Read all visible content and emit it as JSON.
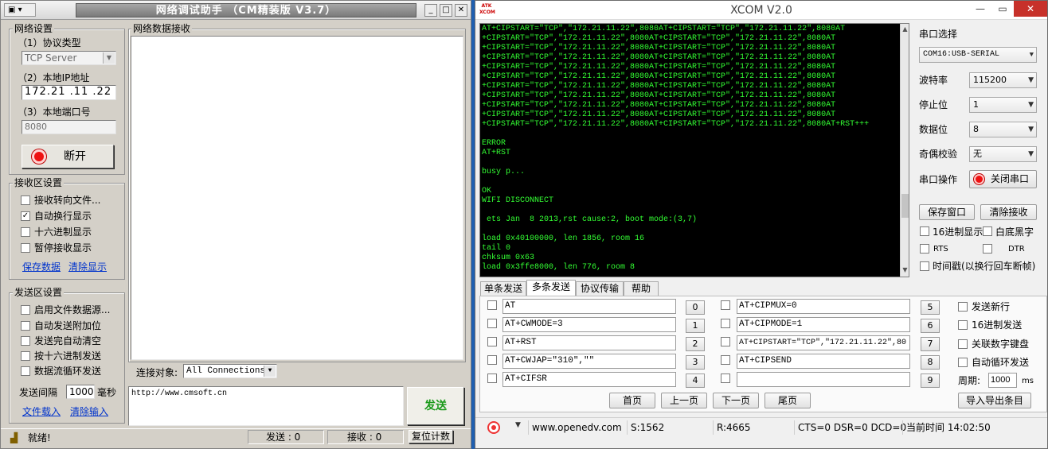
{
  "left": {
    "title": "网络调试助手 （CM精装版 V3.7）",
    "net_settings": {
      "title": "网络设置",
      "protocol_label": "（1）协议类型",
      "protocol_value": "TCP Server",
      "ip_label": "（2）本地IP地址",
      "ip_value": "172.21 .11 .22",
      "port_label": "（3）本地端口号",
      "port_value": "8080",
      "disconnect_label": "断开"
    },
    "recv_settings": {
      "title": "接收区设置",
      "options": [
        {
          "label": "接收转向文件...",
          "checked": false
        },
        {
          "label": "自动换行显示",
          "checked": true
        },
        {
          "label": "十六进制显示",
          "checked": false
        },
        {
          "label": "暂停接收显示",
          "checked": false
        }
      ],
      "save_link": "保存数据",
      "clear_link": "清除显示"
    },
    "send_settings": {
      "title": "发送区设置",
      "options": [
        {
          "label": "启用文件数据源...",
          "checked": false
        },
        {
          "label": "自动发送附加位",
          "checked": false
        },
        {
          "label": "发送完自动清空",
          "checked": false
        },
        {
          "label": "按十六进制发送",
          "checked": false
        },
        {
          "label": "数据流循环发送",
          "checked": false
        }
      ],
      "interval_label": "发送间隔",
      "interval_value": "1000",
      "interval_unit": "毫秒",
      "load_link": "文件载入",
      "clear_input_link": "清除输入"
    },
    "recv_area_title": "网络数据接收",
    "connect_label": "连接对象:",
    "connect_value": "All Connections",
    "send_text": "http://www.cmsoft.cn",
    "send_button": "发送",
    "status": {
      "ready": "就绪!",
      "send_count": "发送 : 0",
      "recv_count": "接收 : 0",
      "reset_button": "复位计数"
    }
  },
  "right": {
    "title": "XCOM V2.0",
    "logo_text": "ATK XCOM",
    "terminal_text": "AT+CIPSTART=\"TCP\",\"172.21.11.22\",8080AT+CIPSTART=\"TCP\",\"172.21.11.22\",8080AT\n+CIPSTART=\"TCP\",\"172.21.11.22\",8080AT+CIPSTART=\"TCP\",\"172.21.11.22\",8080AT\n+CIPSTART=\"TCP\",\"172.21.11.22\",8080AT+CIPSTART=\"TCP\",\"172.21.11.22\",8080AT\n+CIPSTART=\"TCP\",\"172.21.11.22\",8080AT+CIPSTART=\"TCP\",\"172.21.11.22\",8080AT\n+CIPSTART=\"TCP\",\"172.21.11.22\",8080AT+CIPSTART=\"TCP\",\"172.21.11.22\",8080AT\n+CIPSTART=\"TCP\",\"172.21.11.22\",8080AT+CIPSTART=\"TCP\",\"172.21.11.22\",8080AT\n+CIPSTART=\"TCP\",\"172.21.11.22\",8080AT+CIPSTART=\"TCP\",\"172.21.11.22\",8080AT\n+CIPSTART=\"TCP\",\"172.21.11.22\",8080AT+CIPSTART=\"TCP\",\"172.21.11.22\",8080AT\n+CIPSTART=\"TCP\",\"172.21.11.22\",8080AT+CIPSTART=\"TCP\",\"172.21.11.22\",8080AT\n+CIPSTART=\"TCP\",\"172.21.11.22\",8080AT+CIPSTART=\"TCP\",\"172.21.11.22\",8080AT\n+CIPSTART=\"TCP\",\"172.21.11.22\",8080AT+CIPSTART=\"TCP\",\"172.21.11.22\",8080AT+RST+++\n\nERROR\nAT+RST\n\nbusy p...\n\nOK\nWIFI DISCONNECT\n\n ets Jan  8 2013,rst cause:2, boot mode:(3,7)\n\nload 0x40100000, len 1856, room 16\ntail 0\nchksum 0x63\nload 0x3ffe8000, len 776, room 8",
    "sidebar": {
      "port_select_label": "串口选择",
      "port_value": "COM16:USB-SERIAL",
      "baud_label": "波特率",
      "baud_value": "115200",
      "stop_label": "停止位",
      "stop_value": "1",
      "data_label": "数据位",
      "data_value": "8",
      "parity_label": "奇偶校验",
      "parity_value": "无",
      "port_op_label": "串口操作",
      "close_port_button": "关闭串口",
      "save_window_button": "保存窗口",
      "clear_recv_button": "清除接收",
      "hex_display": "16进制显示",
      "white_black": "白底黑字",
      "rts": "RTS",
      "dtr": "DTR",
      "timestamp": "时间戳(以换行回车断帧)"
    },
    "tabs": [
      "单条发送",
      "多条发送",
      "协议传输",
      "帮助"
    ],
    "commands_left": [
      {
        "text": "AT",
        "num": "0"
      },
      {
        "text": "AT+CWMODE=3",
        "num": "1"
      },
      {
        "text": "AT+RST",
        "num": "2"
      },
      {
        "text": "AT+CWJAP=\"310\",\"\"",
        "num": "3"
      },
      {
        "text": "AT+CIFSR",
        "num": "4"
      }
    ],
    "commands_right": [
      {
        "text": "AT+CIPMUX=0",
        "num": "5"
      },
      {
        "text": "AT+CIPMODE=1",
        "num": "6"
      },
      {
        "text": "AT+CIPSTART=\"TCP\",\"172.21.11.22\",80",
        "num": "7"
      },
      {
        "text": "AT+CIPSEND",
        "num": "8"
      },
      {
        "text": "",
        "num": "9"
      }
    ],
    "send_opts": {
      "newline": "发送新行",
      "hex_send": "16进制发送",
      "keyboard": "关联数字键盘",
      "loop_send": "自动循环发送",
      "period_label": "周期:",
      "period_value": "1000",
      "period_unit": "ms"
    },
    "nav": {
      "first": "首页",
      "prev": "上一页",
      "next": "下一页",
      "last": "尾页",
      "import_export": "导入导出条目"
    },
    "status": {
      "url": "www.openedv.com",
      "sent": "S:1562",
      "recv": "R:4665",
      "signals": "CTS=0 DSR=0 DCD=0",
      "time": "当前时间 14:02:50"
    }
  }
}
